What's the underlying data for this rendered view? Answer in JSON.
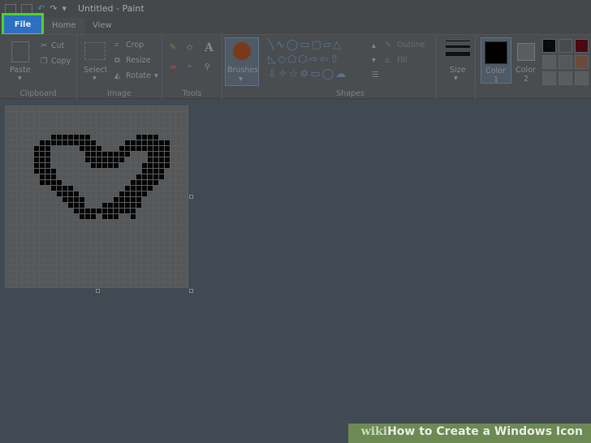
{
  "window": {
    "title": "Untitled - Paint"
  },
  "tabs": {
    "file": "File",
    "home": "Home",
    "view": "View"
  },
  "clipboard": {
    "paste": "Paste",
    "cut": "Cut",
    "copy": "Copy",
    "label": "Clipboard"
  },
  "image": {
    "select": "Select",
    "crop": "Crop",
    "resize": "Resize",
    "rotate": "Rotate",
    "label": "Image"
  },
  "tools": {
    "label": "Tools"
  },
  "brushes": {
    "label": "Brushes"
  },
  "shapes": {
    "outline": "Outline",
    "fill": "Fill",
    "label": "Shapes"
  },
  "size": {
    "label": "Size"
  },
  "colors": {
    "color1": "Color",
    "color1_num": "1",
    "color2": "Color",
    "color2_num": "2",
    "palette": [
      "#0a0a0a",
      "#4a4a4a",
      "#4a0a10",
      "#5a5c5e",
      "#555759",
      "#6a4a3a",
      "#5a5c5e",
      "#5a5c5e",
      "#5a5c5e"
    ]
  },
  "watermark": {
    "brand": "wiki",
    "text": "How to Create a Windows Icon"
  },
  "accent": {
    "file_tab": "#2d6fc1",
    "highlight": "#4fd12a"
  }
}
